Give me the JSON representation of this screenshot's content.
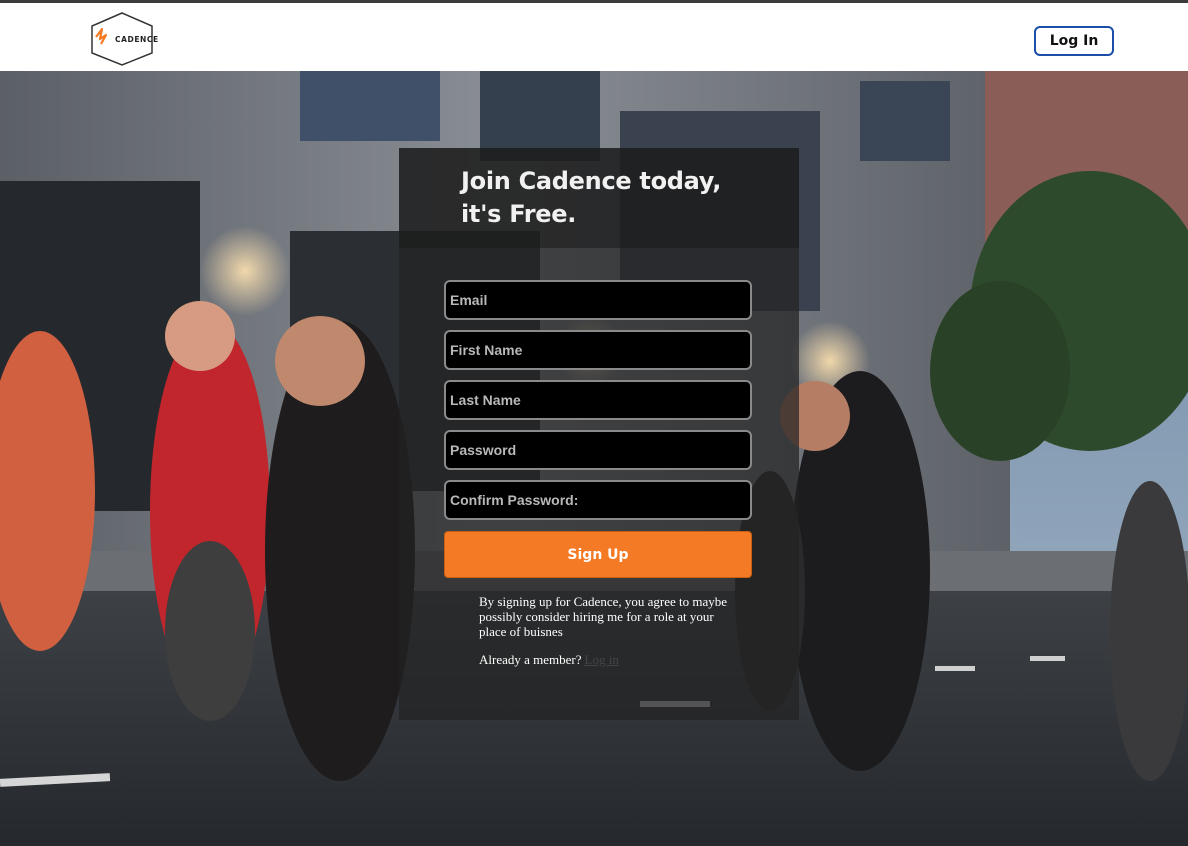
{
  "brand": {
    "name": "CADENCE",
    "logo_icon": "cadence-logo-icon",
    "accent_color": "#f47a25"
  },
  "navbar": {
    "login_label": "Log In"
  },
  "signup": {
    "title": "Join Cadence today,\nit's Free.",
    "fields": {
      "email_placeholder": "Email",
      "first_name_placeholder": "First Name",
      "last_name_placeholder": "Last Name",
      "password_placeholder": "Password",
      "confirm_password_placeholder": "Confirm Password:"
    },
    "submit_label": "Sign Up",
    "terms_text": "By signing up for Cadence, you agree to maybe possibly consider hiring me for a role at your place of buisnes",
    "member_prompt": "Already a member?",
    "member_link": "Log in"
  }
}
